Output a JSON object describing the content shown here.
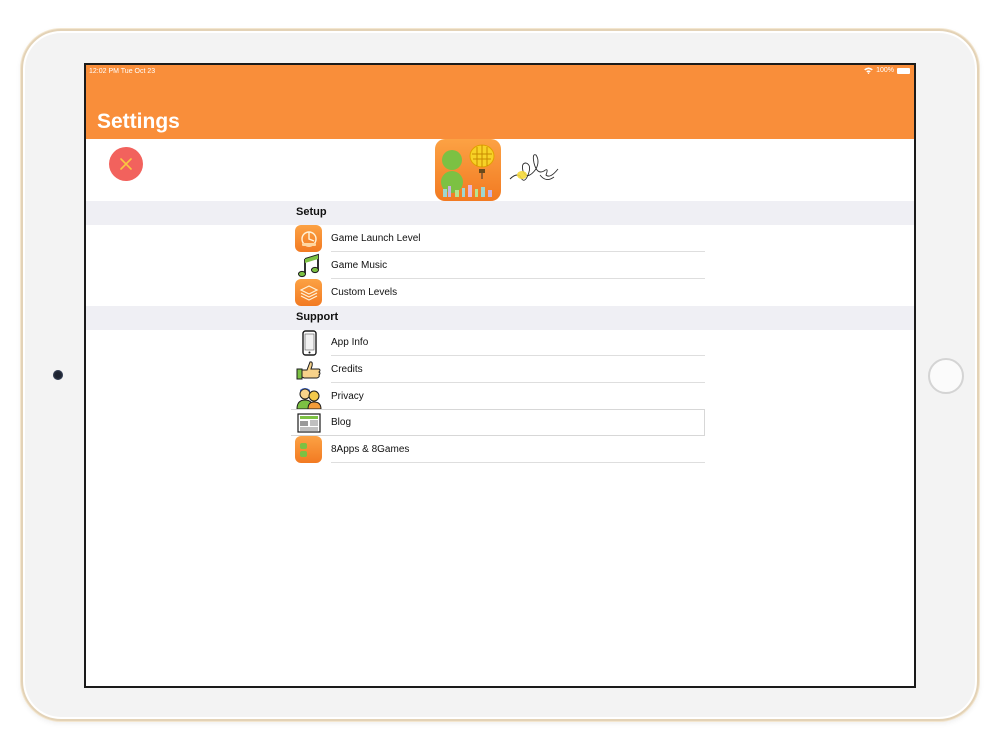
{
  "status_bar": {
    "time": "12:02 PM   Tue Oct 23",
    "battery": "100%"
  },
  "nav": {
    "title": "Settings"
  },
  "sections": [
    {
      "title": "Setup",
      "items": [
        {
          "label": "Game Launch Level",
          "icon": "launch-level-icon"
        },
        {
          "label": "Game Music",
          "icon": "music-note-icon"
        },
        {
          "label": "Custom Levels",
          "icon": "layers-icon"
        }
      ]
    },
    {
      "title": "Support",
      "items": [
        {
          "label": "App Info",
          "icon": "phone-icon"
        },
        {
          "label": "Credits",
          "icon": "thumbs-up-icon"
        },
        {
          "label": "Privacy",
          "icon": "people-icon"
        },
        {
          "label": "Blog",
          "icon": "newspaper-icon"
        },
        {
          "label": "8Apps & 8Games",
          "icon": "8apps-icon"
        }
      ]
    }
  ],
  "colors": {
    "nav_bar": "#f98e3a",
    "close_button": "#f2625d",
    "section_bg": "#efeff4"
  }
}
